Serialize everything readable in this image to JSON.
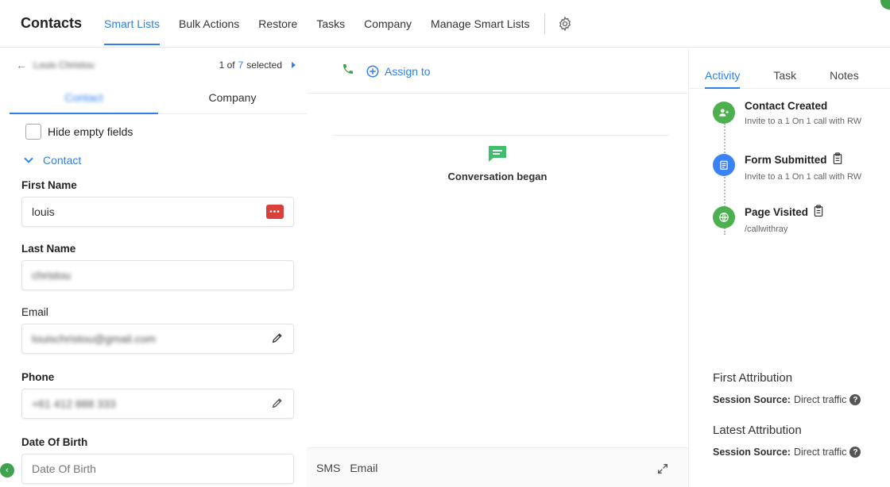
{
  "header": {
    "brand": "Contacts",
    "tabs": [
      {
        "label": "Smart Lists",
        "active": true
      },
      {
        "label": "Bulk Actions",
        "active": false
      },
      {
        "label": "Restore",
        "active": false
      },
      {
        "label": "Tasks",
        "active": false
      },
      {
        "label": "Company",
        "active": false
      },
      {
        "label": "Manage Smart Lists",
        "active": false
      }
    ],
    "settings_icon": "gear-icon"
  },
  "left": {
    "contact_name_blurred": "Louis Christou",
    "pager": {
      "current": "1 of",
      "total": "7",
      "suffix": "selected"
    },
    "subtabs": [
      {
        "label": "Contact",
        "active": true
      },
      {
        "label": "Company",
        "active": false
      }
    ],
    "hide_empty_label": "Hide empty fields",
    "section_label": "Contact",
    "fields": {
      "first_name": {
        "label": "First Name",
        "value": "louis"
      },
      "last_name": {
        "label": "Last Name",
        "value": "christou"
      },
      "email": {
        "label": "Email",
        "value": "louischristou@gmail.com"
      },
      "phone": {
        "label": "Phone",
        "value": "+61 412 888 333"
      },
      "dob": {
        "label": "Date Of Birth",
        "placeholder": "Date Of Birth"
      }
    }
  },
  "center": {
    "assign_label": "Assign to",
    "conversation_label": "Conversation began",
    "composer": {
      "sms": "SMS",
      "email": "Email"
    }
  },
  "right": {
    "tabs": [
      {
        "label": "Activity",
        "active": true
      },
      {
        "label": "Task",
        "active": false
      },
      {
        "label": "Notes",
        "active": false
      }
    ],
    "activity": [
      {
        "title": "Contact Created",
        "sub": "Invite to a 1 On 1 call with RW",
        "color": "#4caf50",
        "icon": "user-add-icon",
        "clipboard": false
      },
      {
        "title": "Form Submitted",
        "sub": "Invite to a 1 On 1 call with RW",
        "color": "#3b82f6",
        "icon": "form-icon",
        "clipboard": true
      },
      {
        "title": "Page Visited",
        "sub": "/callwithray",
        "color": "#4caf50",
        "icon": "globe-icon",
        "clipboard": true
      }
    ],
    "first_attribution": {
      "title": "First Attribution",
      "key": "Session Source:",
      "value": "Direct traffic"
    },
    "latest_attribution": {
      "title": "Latest Attribution",
      "key": "Session Source:",
      "value": "Direct traffic"
    }
  },
  "colors": {
    "accent": "#2f80ed",
    "green": "#4caf50",
    "red": "#d9403a"
  }
}
